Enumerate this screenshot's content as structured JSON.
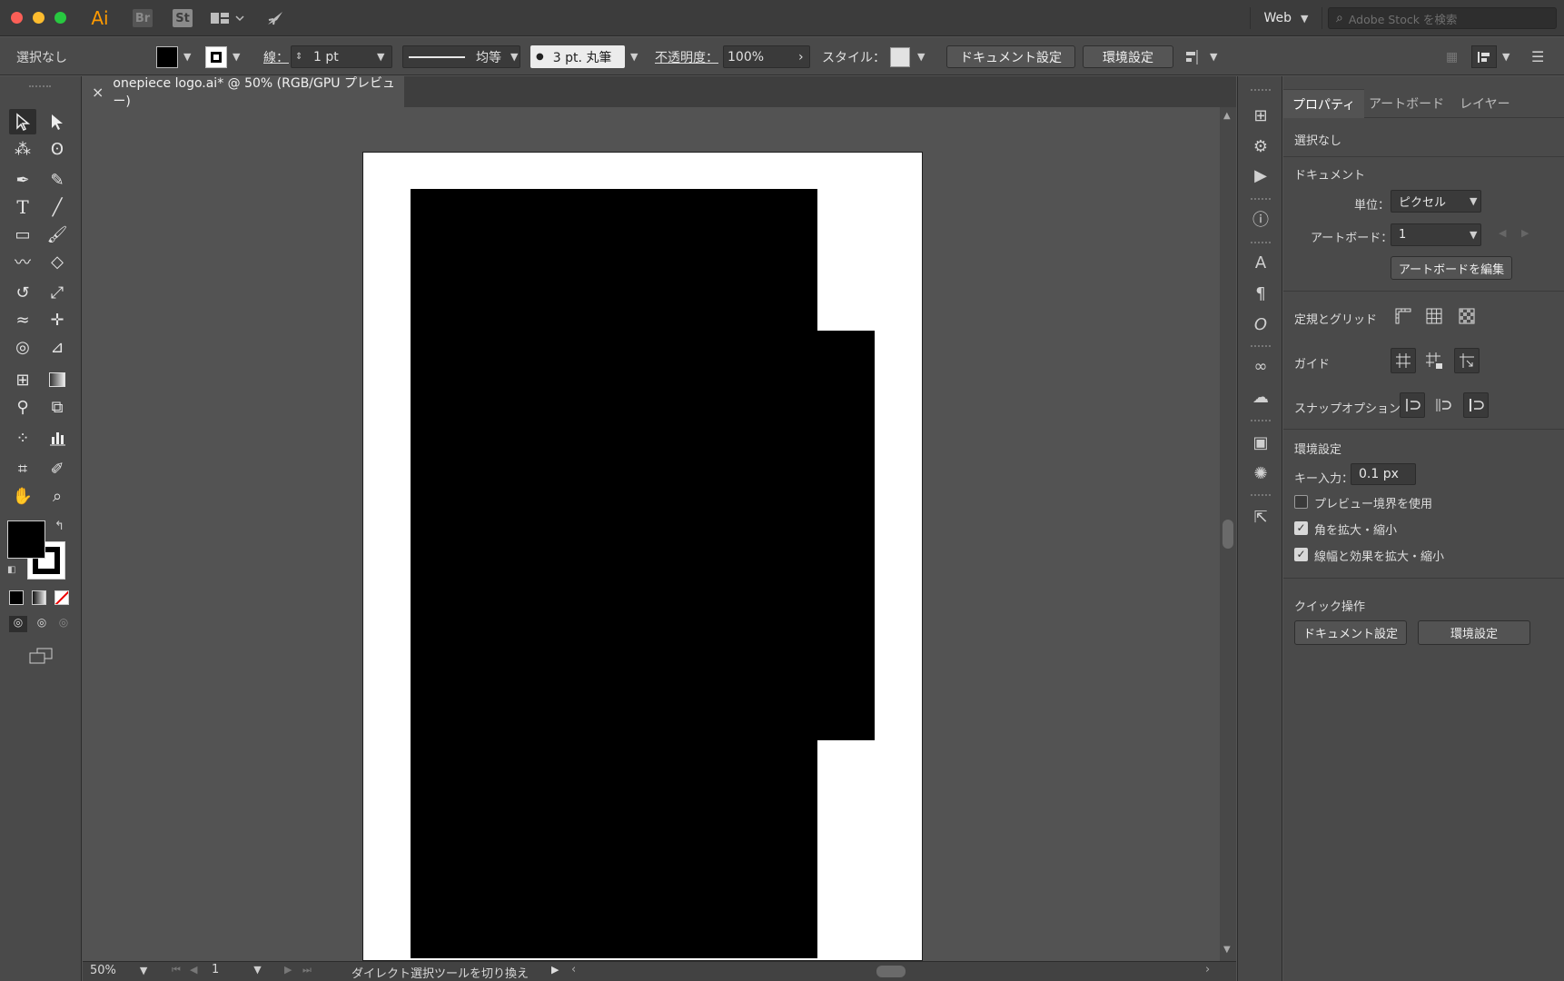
{
  "app": {
    "logo": "Ai",
    "bridge": "Br",
    "stock": "St",
    "workspace": "Web",
    "search_placeholder": "Adobe Stock を検索"
  },
  "control_bar": {
    "selection": "選択なし",
    "stroke_label": "線：",
    "stroke_weight": "1 pt",
    "stroke_profile": "均等",
    "brush": "3 pt. 丸筆",
    "opacity_label": "不透明度：",
    "opacity_value": "100%",
    "style_label": "スタイル：",
    "doc_settings_button": "ドキュメント設定",
    "preferences_button": "環境設定"
  },
  "document": {
    "tab_title": "onepiece logo.ai* @ 50% (RGB/GPU プレビュー)",
    "close": "×"
  },
  "status_bar": {
    "zoom": "50%",
    "artboard_number": "1",
    "status_text": "ダイレクト選択ツールを切り換え"
  },
  "properties_panel": {
    "tabs": [
      "プロパティ",
      "アートボード",
      "レイヤー"
    ],
    "selection": "選択なし",
    "document_section": "ドキュメント",
    "units_label": "単位：",
    "units_value": "ピクセル",
    "artboard_label": "アートボード：",
    "artboard_value": "1",
    "edit_artboards_button": "アートボードを編集",
    "rulers_grid_label": "定規とグリッド",
    "guides_label": "ガイド",
    "snap_label": "スナップオプション",
    "preferences_section": "環境設定",
    "keyboard_increment_label": "キー入力：",
    "keyboard_increment_value": "0.1 px",
    "checkboxes": [
      {
        "label": "プレビュー境界を使用",
        "checked": false
      },
      {
        "label": "角を拡大・縮小",
        "checked": true
      },
      {
        "label": "線幅と効果を拡大・縮小",
        "checked": true
      }
    ],
    "quick_actions_label": "クイック操作",
    "quick_doc_settings_button": "ドキュメント設定",
    "quick_preferences_button": "環境設定"
  },
  "colors": {
    "fill": "#000000",
    "stroke": "#000000",
    "accent_ui": "#535353",
    "shape": "#000000"
  }
}
